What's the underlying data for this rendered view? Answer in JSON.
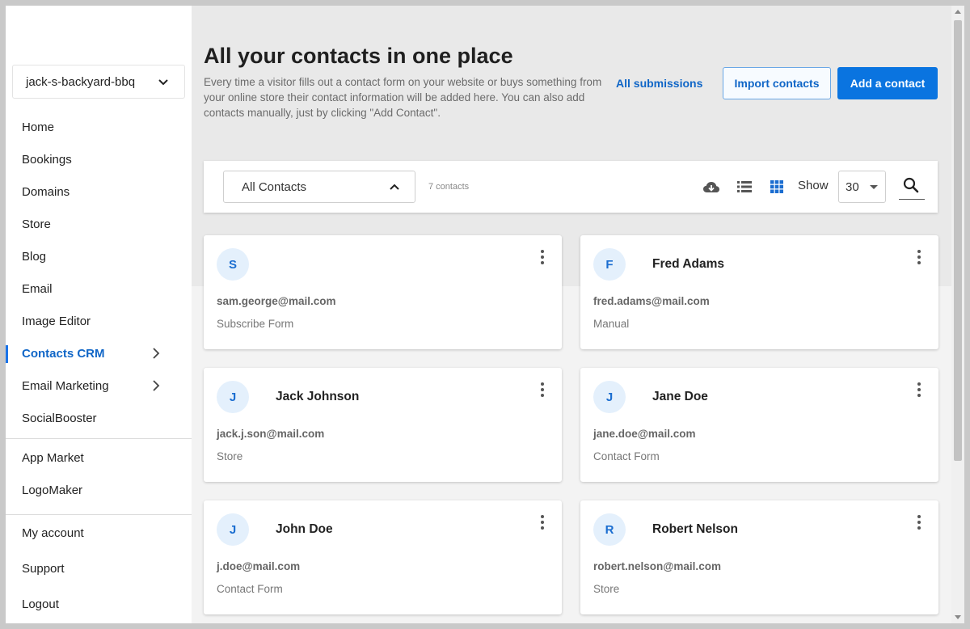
{
  "sidebar": {
    "site_name": "jack-s-backyard-bbq",
    "nav_main": [
      {
        "label": "Home"
      },
      {
        "label": "Bookings"
      },
      {
        "label": "Domains"
      },
      {
        "label": "Store"
      },
      {
        "label": "Blog"
      },
      {
        "label": "Email"
      },
      {
        "label": "Image Editor"
      },
      {
        "label": "Contacts CRM"
      },
      {
        "label": "Email Marketing"
      },
      {
        "label": "SocialBooster"
      }
    ],
    "nav_apps": [
      {
        "label": "App Market"
      },
      {
        "label": "LogoMaker"
      }
    ],
    "nav_account": [
      {
        "label": "My account"
      },
      {
        "label": "Support"
      },
      {
        "label": "Logout"
      }
    ]
  },
  "header": {
    "title": "All your contacts in one place",
    "description": "Every time a visitor fills out a contact form on your website or buys something from your online store their contact information will be added here. You can also add contacts manually, just by clicking \"Add Contact\".",
    "all_submissions_label": "All submissions",
    "import_label": "Import contacts",
    "add_label": "Add a contact"
  },
  "toolbar": {
    "filter_value": "All Contacts",
    "count_text": "7 contacts",
    "show_label": "Show",
    "page_size": "30"
  },
  "contacts": [
    {
      "initial": "S",
      "name": "",
      "email": "sam.george@mail.com",
      "source": "Subscribe Form"
    },
    {
      "initial": "F",
      "name": "Fred Adams",
      "email": "fred.adams@mail.com",
      "source": "Manual"
    },
    {
      "initial": "J",
      "name": "Jack Johnson",
      "email": "jack.j.son@mail.com",
      "source": "Store"
    },
    {
      "initial": "J",
      "name": "Jane Doe",
      "email": "jane.doe@mail.com",
      "source": "Contact Form"
    },
    {
      "initial": "J",
      "name": "John Doe",
      "email": "j.doe@mail.com",
      "source": "Contact Form"
    },
    {
      "initial": "R",
      "name": "Robert Nelson",
      "email": "robert.nelson@mail.com",
      "source": "Store"
    }
  ],
  "colors": {
    "accent": "#0a74e0",
    "link": "#1066c7",
    "avatar_bg": "#e4f0fc"
  },
  "icons": {
    "site_select": "chevron-down-icon",
    "filter_select": "chevron-up-icon",
    "export": "cloud-download-icon",
    "list_view": "list-view-icon",
    "grid_view": "grid-view-icon",
    "search": "search-icon",
    "card_menu": "kebab-menu-icon",
    "submenu": "chevron-right-icon"
  }
}
